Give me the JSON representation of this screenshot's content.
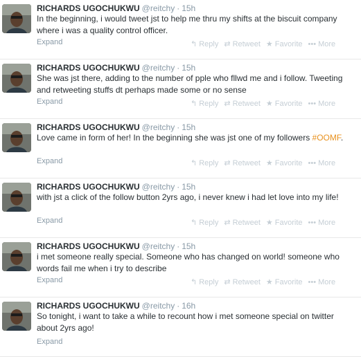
{
  "tweets": [
    {
      "name": "RICHARDS UGOCHUKWU",
      "handle": "@reitchy",
      "sep": "·",
      "time": "15h",
      "text": "In the beginning, i would tweet jst to help me thru my shifts at the biscuit company where i was a quality control officer.",
      "hashtag": "",
      "suffix": "",
      "expand": "Expand"
    },
    {
      "name": "RICHARDS UGOCHUKWU",
      "handle": "@reitchy",
      "sep": "·",
      "time": "15h",
      "text": "She was jst there, adding to the number of pple who fllwd me and i follow. Tweeting and retweeting stuffs dt perhaps made some or no sense",
      "hashtag": "",
      "suffix": "",
      "expand": "Expand"
    },
    {
      "name": "RICHARDS UGOCHUKWU",
      "handle": "@reitchy",
      "sep": "·",
      "time": "15h",
      "text": "Love came in form of her! In the beginning she was jst one of my followers ",
      "hashtag": "#OOMF",
      "suffix": ".",
      "expand": "Expand"
    },
    {
      "name": "RICHARDS UGOCHUKWU",
      "handle": "@reitchy",
      "sep": "·",
      "time": "15h",
      "text": "with jst a click of the follow button 2yrs ago, i never knew i had let love into my life!",
      "hashtag": "",
      "suffix": "",
      "expand": "Expand"
    },
    {
      "name": "RICHARDS UGOCHUKWU",
      "handle": "@reitchy",
      "sep": "·",
      "time": "15h",
      "text": "i met someone really special. Someone who has changed on world! someone who words fail me when i try to describe",
      "hashtag": "",
      "suffix": "",
      "expand": "Expand"
    },
    {
      "name": "RICHARDS UGOCHUKWU",
      "handle": "@reitchy",
      "sep": "·",
      "time": "16h",
      "text": "So tonight, i want to take a while to recount how i met someone special on twitter about 2yrs ago!",
      "hashtag": "",
      "suffix": "",
      "expand": "Expand"
    }
  ],
  "actions": {
    "reply": "Reply",
    "retweet": "Retweet",
    "favorite": "Favorite",
    "more": "More",
    "reply_icon": "reply-arrow-icon",
    "retweet_icon": "retweet-icon",
    "favorite_icon": "star-icon",
    "more_icon": "ellipsis-icon"
  },
  "colors": {
    "name": "#292f33",
    "meta": "#8899a6",
    "hashtag": "#e8911e",
    "actions": "#c5ced5",
    "divider": "#e8e8e8"
  }
}
